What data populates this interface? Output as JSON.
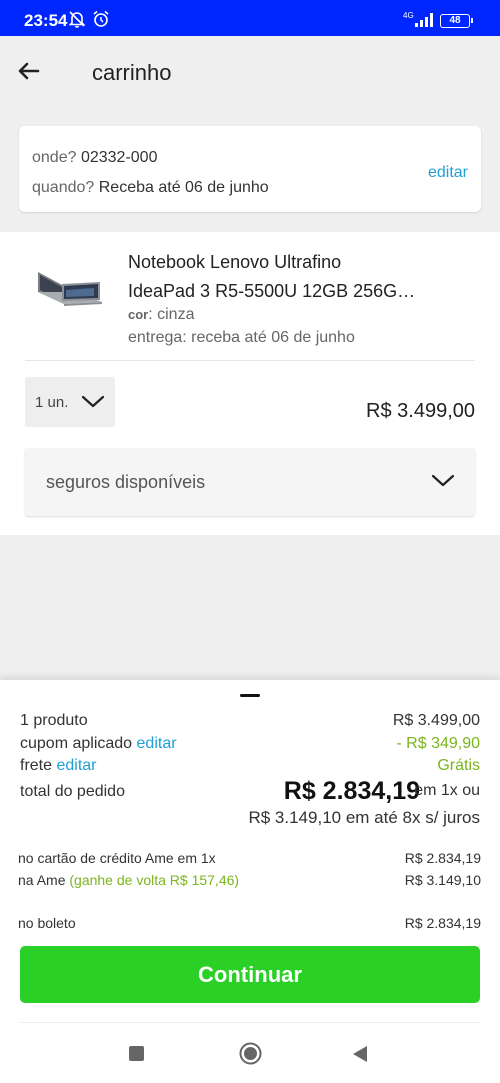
{
  "status_bar": {
    "time": "23:54",
    "network": "4G",
    "battery": "48"
  },
  "app_bar": {
    "title": "carrinho"
  },
  "delivery": {
    "where_label": "onde?",
    "where_value": "02332-000",
    "when_label": "quando?",
    "when_value": "Receba até 06 de junho",
    "edit_label": "editar"
  },
  "product": {
    "name_line1": "Notebook Lenovo Ultrafino",
    "name_line2": "IdeaPad 3 R5-5500U 12GB 256G…",
    "color_label": "cor",
    "color_value": "cinza",
    "delivery_text": "entrega: receba até 06 de junho",
    "quantity": "1 un.",
    "price": "R$ 3.499,00",
    "insurance_label": "seguros disponíveis"
  },
  "summary": {
    "products_label": "1 produto",
    "products_value": "R$ 3.499,00",
    "coupon_label": "cupom aplicado",
    "coupon_edit": "editar",
    "coupon_value": "- R$ 349,90",
    "shipping_label": "frete",
    "shipping_edit": "editar",
    "shipping_value": "Grátis",
    "total_label": "total do pedido",
    "total_value": "R$ 2.834,19",
    "total_suffix": "em 1x ou",
    "installment_text": "R$ 3.149,10 em até 8x s/ juros"
  },
  "payment_options": {
    "ame_card_label": "no cartão de crédito Ame em 1x",
    "ame_card_value": "R$ 2.834,19",
    "ame_label": "na Ame",
    "ame_cashback": "(ganhe de volta R$ 157,46)",
    "ame_value": "R$ 3.149,10",
    "boleto_label": "no boleto",
    "boleto_value": "R$ 2.834,19"
  },
  "cta": {
    "label": "Continuar"
  },
  "colors": {
    "status_bar": "#0026ff",
    "link": "#1ea0d6",
    "discount_green": "#7ab51d",
    "cta_green": "#2ad026"
  },
  "icons": [
    "mute-bell-icon",
    "alarm-icon",
    "signal-icon",
    "battery-icon",
    "back-arrow-icon",
    "laptop-image",
    "chevron-down-icon",
    "nav-recents-icon",
    "nav-home-icon",
    "nav-back-icon"
  ]
}
